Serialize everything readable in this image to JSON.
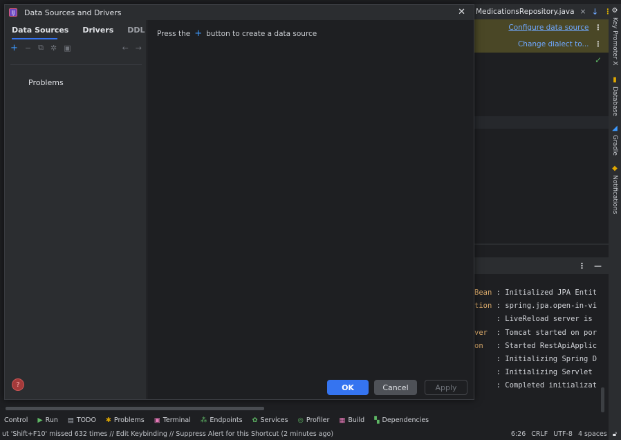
{
  "dialog": {
    "title": "Data Sources and Drivers",
    "close_glyph": "✕",
    "tabs": [
      {
        "label": "Data Sources"
      },
      {
        "label": "Drivers"
      },
      {
        "label": "DDL M"
      }
    ],
    "problems_label": "Problems",
    "hint": {
      "before": "Press the",
      "plus": "+",
      "after": "button to create a data source"
    },
    "buttons": {
      "ok": "OK",
      "cancel": "Cancel",
      "apply": "Apply",
      "help": "?"
    }
  },
  "editor": {
    "tab_label": "MedicationsRepository.java",
    "tab_close": "×",
    "banner1_link": "Configure data source",
    "banner2_link": "Change dialect to..."
  },
  "console": {
    "lines": [
      {
        "prefix": "Bean",
        "text": " : Initialized JPA Entit"
      },
      {
        "prefix": "tion",
        "text": " : spring.jpa.open-in-vi"
      },
      {
        "prefix": "    ",
        "text": " : LiveReload server is "
      },
      {
        "prefix": "ver ",
        "text": " : Tomcat started on por"
      },
      {
        "prefix": "on  ",
        "text": " : Started RestApiApplic"
      },
      {
        "prefix": "    ",
        "text": " : Initializing Spring D"
      },
      {
        "prefix": "    ",
        "text": " : Initializing Servlet "
      },
      {
        "prefix": "    ",
        "text": " : Completed initializat"
      }
    ]
  },
  "side_tools": [
    {
      "label": "Key Promoter X",
      "icon": "key-promoter-icon"
    },
    {
      "label": "Database",
      "icon": "database-icon"
    },
    {
      "label": "Gradle",
      "icon": "gradle-icon"
    },
    {
      "label": "Notifications",
      "icon": "bell-icon"
    }
  ],
  "toolwindows": [
    {
      "label": "Control",
      "icon": ""
    },
    {
      "label": "Run",
      "icon": "run-icon"
    },
    {
      "label": "TODO",
      "icon": "todo-icon"
    },
    {
      "label": "Problems",
      "icon": "problems-icon"
    },
    {
      "label": "Terminal",
      "icon": "terminal-icon"
    },
    {
      "label": "Endpoints",
      "icon": "endpoints-icon"
    },
    {
      "label": "Services",
      "icon": "services-icon"
    },
    {
      "label": "Profiler",
      "icon": "profiler-icon"
    },
    {
      "label": "Build",
      "icon": "build-icon"
    },
    {
      "label": "Dependencies",
      "icon": "dependencies-icon"
    }
  ],
  "statusbar": {
    "message": "ut 'Shift+F10' missed 632 times // Edit Keybinding // Suppress Alert for this Shortcut (2 minutes ago)",
    "position": "6:26",
    "line_sep": "CRLF",
    "encoding": "UTF-8",
    "indent": "4 spaces"
  },
  "colors": {
    "accent": "#3574f0",
    "banner": "#4a4726",
    "link": "#6fa8ff"
  }
}
